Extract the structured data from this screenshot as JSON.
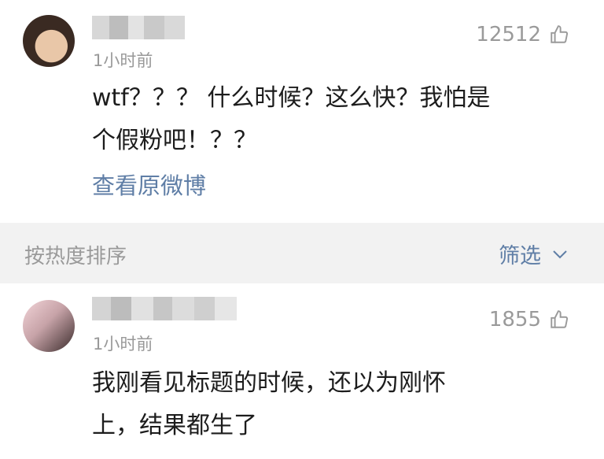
{
  "comments": [
    {
      "time": "1小时前",
      "likes": "12512",
      "text": "wtf？？？ 什么时候？这么快？我怕是\n个假粉吧！？？",
      "link": "查看原微博"
    },
    {
      "time": "1小时前",
      "likes": "1855",
      "text": "我刚看见标题的时候，还以为刚怀\n上，结果都生了"
    }
  ],
  "sortbar": {
    "label": "按热度排序",
    "filter": "筛选"
  },
  "icons": {
    "like": "thumbs-up-icon",
    "chevron": "chevron-down-icon"
  },
  "colors": {
    "link": "#5f7ea6",
    "muted": "#999999",
    "sortbar_bg": "#f2f2f2"
  }
}
